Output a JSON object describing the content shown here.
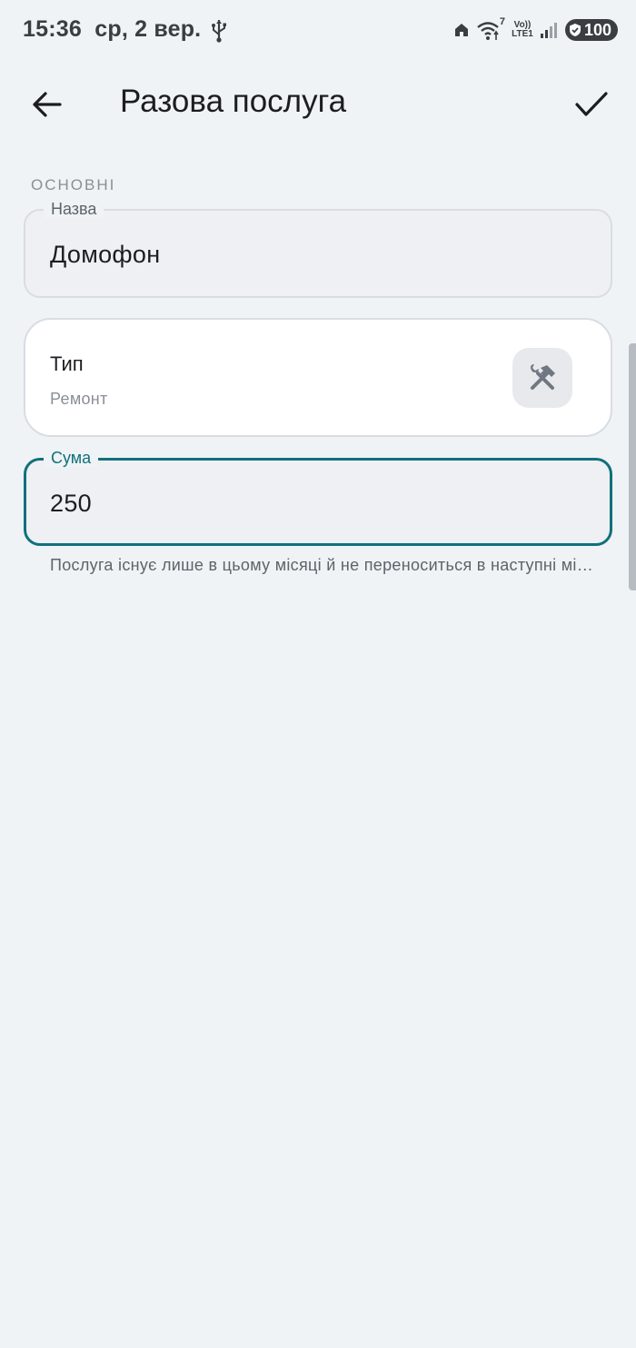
{
  "status_bar": {
    "time": "15:36",
    "date": "ср, 2 вер.",
    "wifi_badge": "7",
    "volte_top": "Vo))",
    "volte_bottom": "LTE1",
    "battery": "100",
    "icons": [
      "usb-icon",
      "home-icon",
      "wifi-icon",
      "signal-icon",
      "battery-saver-shield-icon"
    ]
  },
  "app_bar": {
    "title": "Разова послуга",
    "back_icon": "arrow-back-icon",
    "confirm_icon": "check-icon"
  },
  "section": {
    "label": "ОСНОВНІ"
  },
  "name_field": {
    "label": "Назва",
    "value": "Домофон"
  },
  "type_card": {
    "title": "Тип",
    "value": "Ремонт",
    "icon": "tools-icon"
  },
  "sum_field": {
    "label": "Сума",
    "value": "250",
    "helper": "Послуга існує лише в цьому місяці й не переноситься в наступні місяці"
  },
  "colors": {
    "background": "#eff3f6",
    "accent": "#11707c",
    "card": "#ffffff",
    "field_fill": "#eef0f3"
  }
}
